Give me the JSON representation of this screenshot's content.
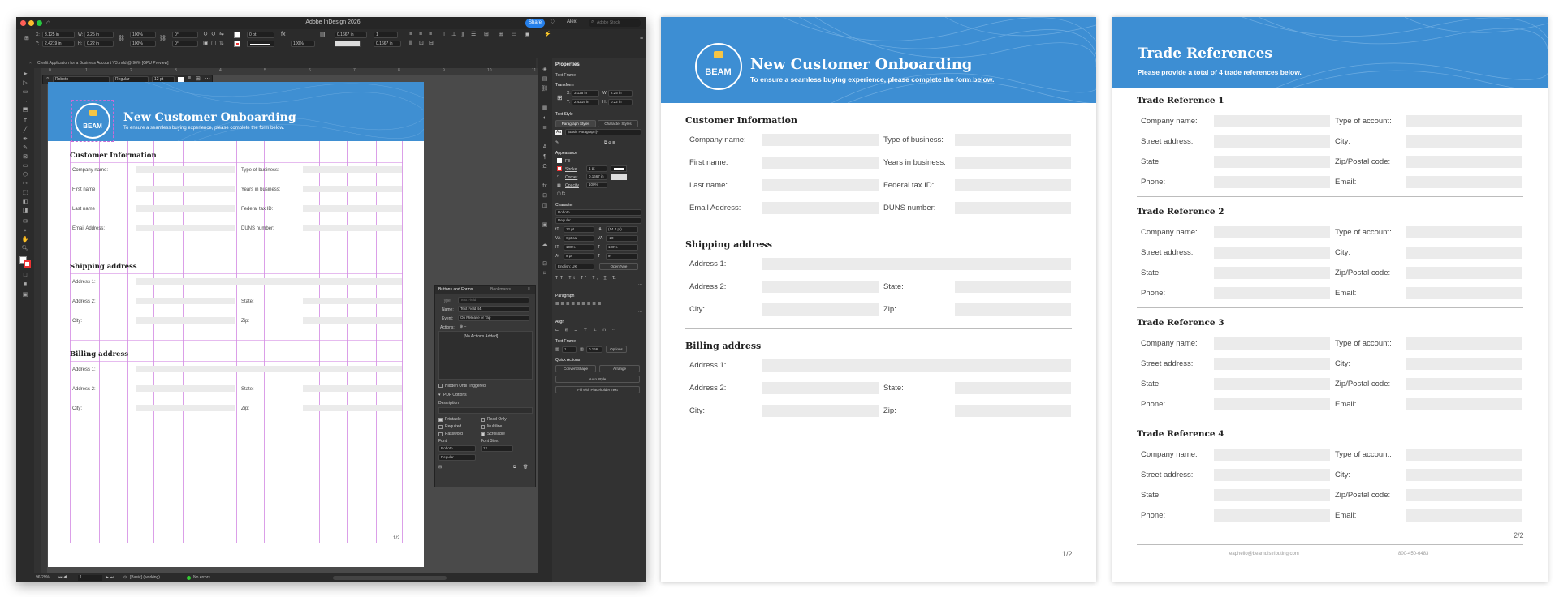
{
  "app": {
    "title": "Adobe InDesign 2026",
    "share_label": "Share",
    "user": "Alex",
    "search_placeholder": "Adobe Stock",
    "doc_tab": "Credit Application for a Business Account V3.indd @ 96% [GPU Preview]",
    "ruler_marks": [
      "0",
      "1",
      "2",
      "3",
      "4",
      "5",
      "6",
      "7",
      "8",
      "9",
      "10",
      "11"
    ],
    "zoom": "96.29%",
    "page_field": "1",
    "page_style": "[Basic] (working)",
    "preflight": "No errors"
  },
  "control": {
    "x": "3.125 in",
    "y": "2.4219 in",
    "w": "2.25 in",
    "h": "0.22 in",
    "scale_x": "100%",
    "scale_y": "100%",
    "rotate": "0°",
    "shear": "0°",
    "stroke": "0 pt",
    "opacity": "100%",
    "offset": "0.1667 in",
    "cols": "1",
    "gutter": "0.1667 in",
    "font": "Roboto",
    "style": "Regular",
    "size": "12 pt"
  },
  "buttons_forms": {
    "tab1": "Buttons and Forms",
    "tab2": "Bookmarks",
    "type_label": "Type:",
    "type_value": "Text Field",
    "name_label": "Name:",
    "name_value": "Text Field 44",
    "event_label": "Event:",
    "event_value": "On Release or Tap",
    "actions_label": "Actions:",
    "no_actions": "[No Actions Added]",
    "hidden": "Hidden Until Triggered",
    "pdf_options": "PDF Options",
    "description": "Description",
    "printable": "Printable",
    "read_only": "Read Only",
    "required": "Required",
    "multiline": "Multiline",
    "password": "Password",
    "scrollable": "Scrollable",
    "font_label": "Font:",
    "font_size_label": "Font Size:",
    "font_value": "Roboto",
    "font_size_value": "12",
    "style_value": "Regular"
  },
  "properties": {
    "title": "Properties",
    "frame_type": "Text Frame",
    "transform": "Transform",
    "x": "3.125 in",
    "y": "2.4219 in",
    "w": "2.25 in",
    "h": "0.22 in",
    "text_style": "Text Style",
    "paragraph_styles": "Paragraph Styles",
    "character_styles": "Character Styles",
    "basic_paragraph": "[Basic Paragraph]+",
    "appearance": "Appearance",
    "fill": "Fill",
    "stroke": "Stroke",
    "stroke_val": "1 pt",
    "corner": "Corner",
    "corner_val": "0.1667 in",
    "opacity": "Opacity",
    "opacity_val": "100%",
    "character": "Character",
    "font": "Roboto",
    "style": "Regular",
    "size": "12 pt",
    "leading": "(14.4 pt)",
    "kerning": "Optical",
    "tracking": "-20",
    "hscale": "100%",
    "vscale": "100%",
    "baseline": "0 pt",
    "skew": "0°",
    "language": "English: UK",
    "opentype": "OpenType",
    "paragraph": "Paragraph",
    "align": "Align",
    "text_frame": "Text Frame",
    "cols_val": "1",
    "gutter_val": "0.166",
    "options": "Options",
    "quick_actions": "Quick Actions",
    "convert_shape": "Convert Shape",
    "arrange": "Arrange",
    "auto_style": "Auto Style",
    "fill_placeholder": "Fill with Placeholder Text"
  },
  "page1": {
    "title": "New Customer Onboarding",
    "subtitle": "To ensure a seamless buying experience, please complete the form below.",
    "logo": "BEAM",
    "sections": {
      "customer": "Customer Information",
      "shipping": "Shipping address",
      "billing": "Billing address"
    },
    "customer_fields": {
      "company": "Company name:",
      "type": "Type of business:",
      "first": "First name:",
      "years": "Years in business:",
      "last": "Last name:",
      "tax": "Federal tax ID:",
      "email": "Email Address:",
      "duns": "DUNS number:"
    },
    "address_fields": {
      "address1": "Address 1:",
      "address2": "Address 2:",
      "state": "State:",
      "city": "City:",
      "zip": "Zip:"
    },
    "page_num": "1/2"
  },
  "mini": {
    "first_name": "First name",
    "last_name": "Last name"
  },
  "page2": {
    "title": "Trade References",
    "subtitle": "Please provide a total of 4 trade references below.",
    "refs": [
      "Trade Reference 1",
      "Trade Reference 2",
      "Trade Reference 3",
      "Trade Reference 4"
    ],
    "fields": {
      "company": "Company name:",
      "account": "Type of account:",
      "street": "Street address:",
      "city": "City:",
      "state": "State:",
      "zip": "Zip/Postal code:",
      "phone": "Phone:",
      "email": "Email:"
    },
    "page_num": "2/2",
    "footer_email": "eaphello@beamdistributing.com",
    "footer_phone": "800-450-6483"
  },
  "colors": {
    "header_blue": "#3d8ed3",
    "share_blue": "#2680eb",
    "field_gray": "#ebebeb",
    "guide_magenta": "#d58ee4"
  }
}
